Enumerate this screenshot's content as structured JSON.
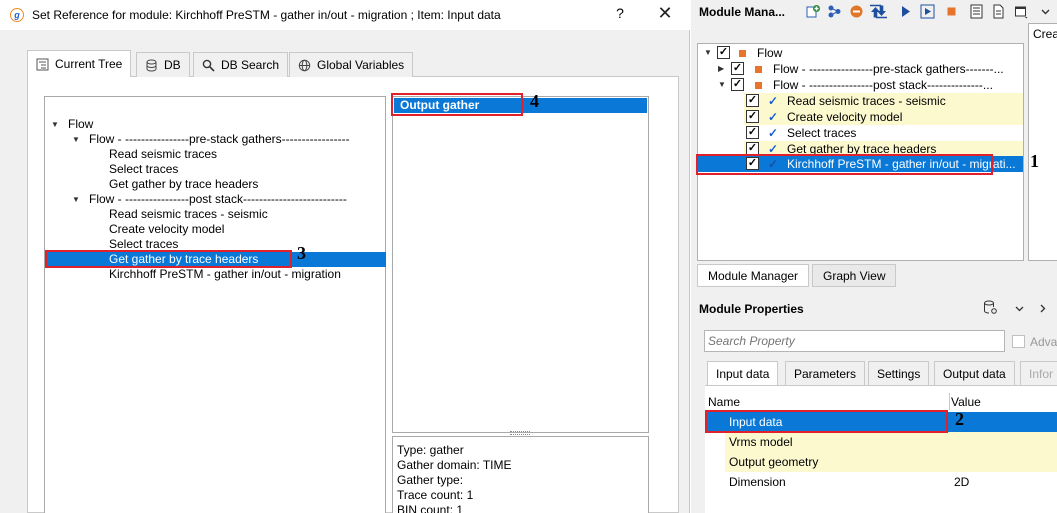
{
  "dialog": {
    "title": "Set Reference for module: Kirchhoff PreSTM - gather in/out - migration ; Item: Input data",
    "app_icon": "g-logo-icon",
    "help": "?",
    "close": "✕",
    "tabs": [
      {
        "label": "Current Tree",
        "icon": "tree-icon"
      },
      {
        "label": "DB",
        "icon": "database-icon"
      },
      {
        "label": "DB Search",
        "icon": "search-icon"
      },
      {
        "label": "Global Variables",
        "icon": "globe-icon"
      }
    ],
    "tree": [
      {
        "label": "Flow"
      },
      {
        "label": "Flow - ----------------pre-stack gathers-----------------"
      },
      {
        "label": "Read seismic traces"
      },
      {
        "label": "Select traces"
      },
      {
        "label": "Get gather by trace headers"
      },
      {
        "label": "Flow - ----------------post stack--------------------------"
      },
      {
        "label": "Read seismic traces - seismic"
      },
      {
        "label": "Create velocity model"
      },
      {
        "label": "Select traces"
      },
      {
        "label": "Get gather by trace headers"
      },
      {
        "label": "Kirchhoff PreSTM - gather in/out - migration"
      }
    ],
    "output_item": "Output gather",
    "info": [
      "Type: gather",
      "Gather domain:   TIME",
      "Gather type:",
      "Trace count:   1",
      "BIN count:      1"
    ]
  },
  "module_manager": {
    "title": "Module Mana...",
    "creat_label": "Creat",
    "tree": [
      {
        "label": "Flow"
      },
      {
        "label": "Flow - ----------------pre-stack gathers-------..."
      },
      {
        "label": "Flow - ----------------post stack--------------..."
      },
      {
        "label": "Read seismic traces - seismic"
      },
      {
        "label": "Create velocity model"
      },
      {
        "label": "Select traces"
      },
      {
        "label": "Get gather by trace headers"
      },
      {
        "label": "Kirchhoff PreSTM - gather in/out - migrati..."
      }
    ],
    "tabs": [
      "Module Manager",
      "Graph View"
    ]
  },
  "module_properties": {
    "title": "Module Properties",
    "search_placeholder": "Search Property",
    "advanced_label": "Adva",
    "tabs": [
      "Input data",
      "Parameters",
      "Settings",
      "Output data",
      "Infor"
    ],
    "col_name": "Name",
    "col_value": "Value",
    "rows": [
      {
        "name": "Input data",
        "value": ""
      },
      {
        "name": "Vrms model",
        "value": ""
      },
      {
        "name": "Output geometry",
        "value": ""
      },
      {
        "name": "Dimension",
        "value": "2D"
      }
    ]
  },
  "annotations": [
    "1",
    "2",
    "3",
    "4"
  ],
  "colors": {
    "selection": "#0a78d7",
    "highlight_yellow": "#fcf9cf",
    "annotation_red": "#e0202a",
    "flow_square": "#e8732a"
  }
}
